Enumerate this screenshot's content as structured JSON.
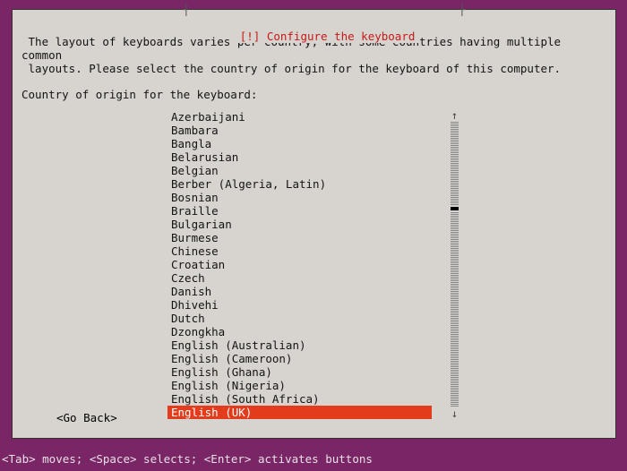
{
  "dialog": {
    "title": "[!] Configure the keyboard",
    "intro": " The layout of keyboards varies per country, with some countries having multiple common\n layouts. Please select the country of origin for the keyboard of this computer.",
    "prompt": " Country of origin for the keyboard:",
    "go_back": "<Go Back>"
  },
  "list": {
    "items": [
      "Azerbaijani",
      "Bambara",
      "Bangla",
      "Belarusian",
      "Belgian",
      "Berber (Algeria, Latin)",
      "Bosnian",
      "Braille",
      "Bulgarian",
      "Burmese",
      "Chinese",
      "Croatian",
      "Czech",
      "Danish",
      "Dhivehi",
      "Dutch",
      "Dzongkha",
      "English (Australian)",
      "English (Cameroon)",
      "English (Ghana)",
      "English (Nigeria)",
      "English (South Africa)",
      "English (UK)"
    ],
    "selected_index": 22
  },
  "scroll": {
    "up_glyph": "↑",
    "down_glyph": "↓"
  },
  "status": "<Tab> moves; <Space> selects; <Enter> activates buttons"
}
